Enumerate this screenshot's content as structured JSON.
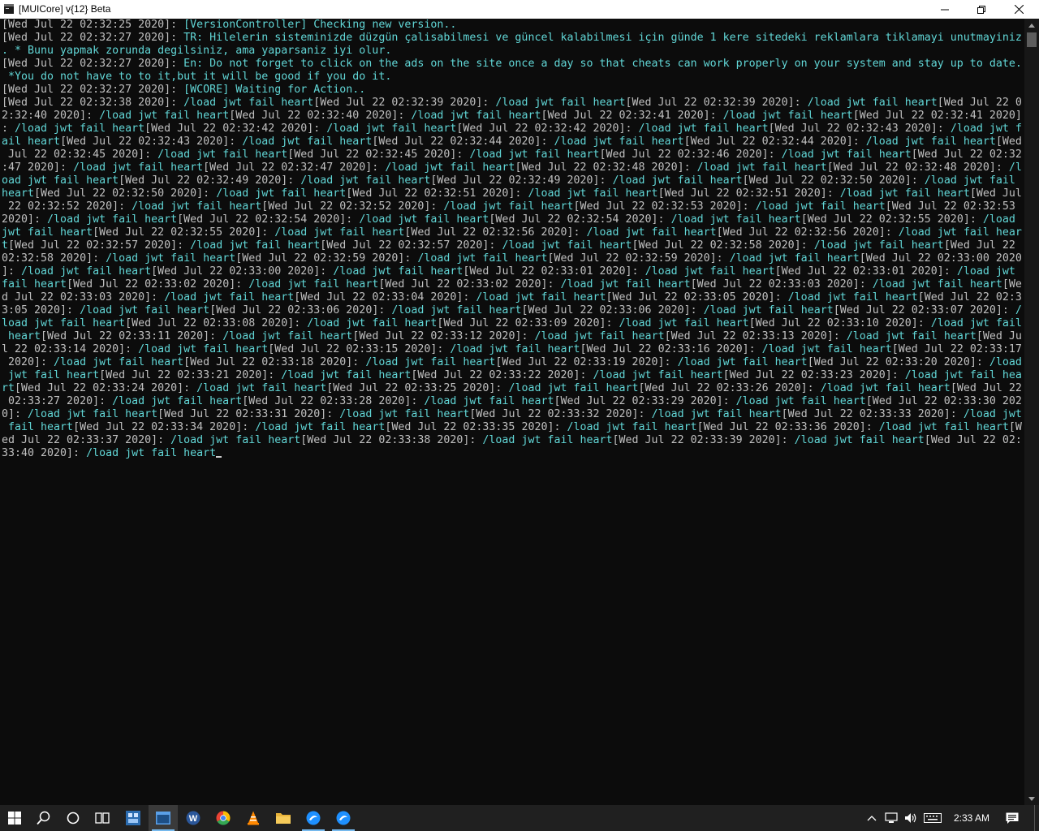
{
  "window": {
    "title": "[MUICore] v{12} Beta"
  },
  "console": {
    "header": [
      {
        "ts": "[Wed Jul 22 02:32:25 2020]: ",
        "msg": "[VersionController] Checking new version.."
      },
      {
        "ts": "[Wed Jul 22 02:32:27 2020]: ",
        "msg": "TR: Hilelerin sisteminizde düzgün çalisabilmesi ve güncel kalabilmesi için günde 1 kere sitedeki reklamlara tiklamayi unutmayiniz"
      },
      {
        "ts": "",
        "msg": ". * Bunu yapmak zorunda degilsiniz, ama yaparsaniz iyi olur."
      },
      {
        "ts": "[Wed Jul 22 02:32:27 2020]: ",
        "msg": "En: Do not forget to click on the ads on the site once a day so that cheats can work properly on your system and stay up to date."
      },
      {
        "ts": "",
        "msg": " *You do not have to to it,but it will be good if you do it."
      },
      {
        "ts": "[Wed Jul 22 02:32:27 2020]: ",
        "msg": "[WCORE] Waiting for Action.."
      }
    ],
    "repeat_message": "/load jwt fail heart",
    "repeat_times": [
      "02:32:38",
      "02:32:39",
      "02:32:39",
      "02:32:40",
      "02:32:40",
      "02:32:41",
      "02:32:41",
      "02:32:42",
      "02:32:42",
      "02:32:43",
      "02:32:43",
      "02:32:44",
      "02:32:44",
      "02:32:45",
      "02:32:45",
      "02:32:46",
      "02:32:47",
      "02:32:47",
      "02:32:48",
      "02:32:48",
      "02:32:49",
      "02:32:49",
      "02:32:50",
      "02:32:50",
      "02:32:51",
      "02:32:51",
      "02:32:52",
      "02:32:52",
      "02:32:53",
      "02:32:53",
      "02:32:54",
      "02:32:54",
      "02:32:55",
      "02:32:55",
      "02:32:56",
      "02:32:56",
      "02:32:57",
      "02:32:57",
      "02:32:58",
      "02:32:58",
      "02:32:59",
      "02:32:59",
      "02:33:00",
      "02:33:00",
      "02:33:01",
      "02:33:01",
      "02:33:02",
      "02:33:02",
      "02:33:03",
      "02:33:03",
      "02:33:04",
      "02:33:05",
      "02:33:05",
      "02:33:06",
      "02:33:06",
      "02:33:07",
      "02:33:08",
      "02:33:09",
      "02:33:10",
      "02:33:11",
      "02:33:12",
      "02:33:13",
      "02:33:14",
      "02:33:15",
      "02:33:16",
      "02:33:17",
      "02:33:18",
      "02:33:19",
      "02:33:20",
      "02:33:21",
      "02:33:22",
      "02:33:23",
      "02:33:24",
      "02:33:25",
      "02:33:26",
      "02:33:27",
      "02:33:28",
      "02:33:29",
      "02:33:30",
      "02:33:31",
      "02:33:32",
      "02:33:33",
      "02:33:34",
      "02:33:35",
      "02:33:36",
      "02:33:37",
      "02:33:38",
      "02:33:39",
      "02:33:40"
    ],
    "date_prefix": "Wed Jul 22 ",
    "year": "2020"
  },
  "taskbar": {
    "clock": "2:33 AM",
    "items": [
      "start-icon",
      "search-icon",
      "cortana-icon",
      "task-view-icon",
      "app-icon",
      "console-icon",
      "word-icon",
      "chrome-icon",
      "vlc-icon",
      "folder-icon",
      "app-blue-icon",
      "app-blue-icon"
    ],
    "tray": [
      "chevron-up-icon",
      "network-icon",
      "volume-icon",
      "keyboard-icon",
      "notification-icon"
    ]
  },
  "colors": {
    "background": "#0c0c0c",
    "text": "#cccccc",
    "message": "#61d6d6"
  }
}
